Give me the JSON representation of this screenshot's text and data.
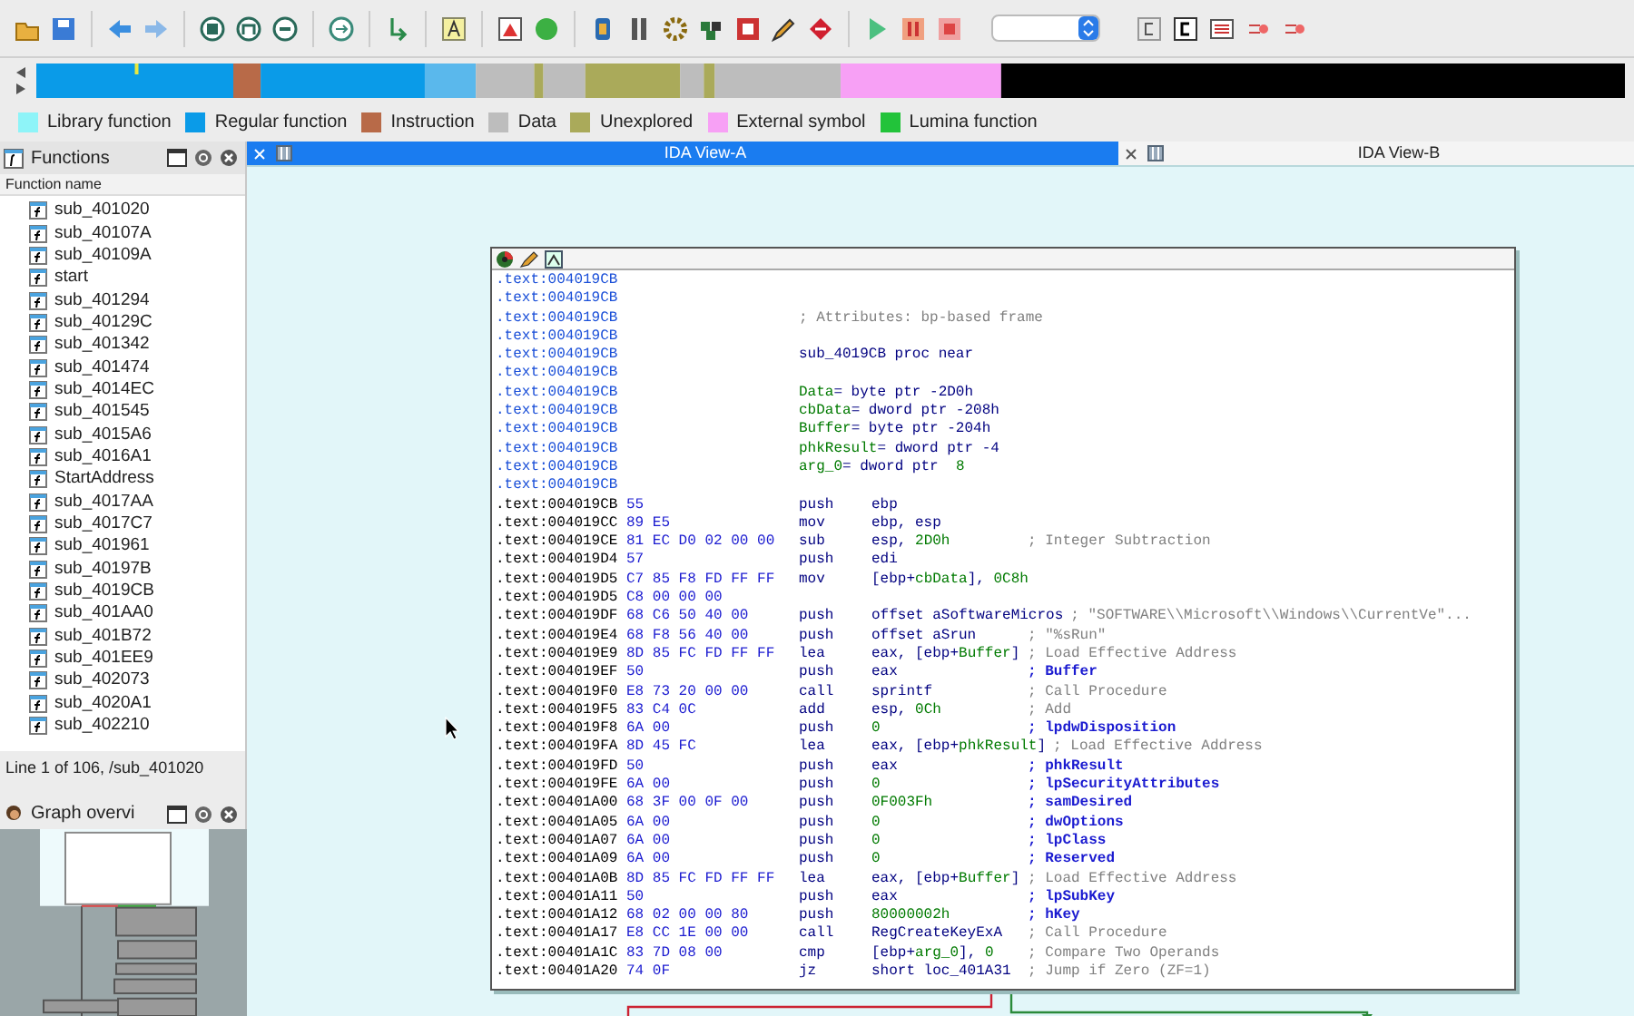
{
  "legend": [
    {
      "label": "Library function",
      "color": "#8ef4f8"
    },
    {
      "label": "Regular function",
      "color": "#0a9be8"
    },
    {
      "label": "Instruction",
      "color": "#b86a48"
    },
    {
      "label": "Data",
      "color": "#bdbdbd"
    },
    {
      "label": "Unexplored",
      "color": "#aaaa5a"
    },
    {
      "label": "External symbol",
      "color": "#f7a0f5"
    },
    {
      "label": "Lumina function",
      "color": "#22c33a"
    }
  ],
  "tabs": [
    {
      "label": "IDA View-A",
      "selected": true
    },
    {
      "label": "IDA View-B",
      "selected": false
    }
  ],
  "functions_panel": {
    "title": "Functions",
    "column": "Function name",
    "items": [
      "sub_401020",
      "sub_40107A",
      "sub_40109A",
      "start",
      "sub_401294",
      "sub_40129C",
      "sub_401342",
      "sub_401474",
      "sub_4014EC",
      "sub_401545",
      "sub_4015A6",
      "sub_4016A1",
      "StartAddress",
      "sub_4017AA",
      "sub_4017C7",
      "sub_401961",
      "sub_40197B",
      "sub_4019CB",
      "sub_401AA0",
      "sub_401B72",
      "sub_401EE9",
      "sub_402073",
      "sub_4020A1",
      "sub_402210"
    ],
    "status": "Line 1 of 106, /sub_401020"
  },
  "graph_overview": {
    "title": "Graph overvi"
  },
  "listing": [
    {
      "kind": "header",
      "addr": ".text:004019CB"
    },
    {
      "kind": "header",
      "addr": ".text:004019CB"
    },
    {
      "kind": "header",
      "addr": ".text:004019CB",
      "ops": [
        {
          "t": "; Attributes: bp-based frame",
          "kind": "note"
        }
      ]
    },
    {
      "kind": "header",
      "addr": ".text:004019CB"
    },
    {
      "kind": "header",
      "addr": ".text:004019CB",
      "ops": [
        {
          "t": "sub_4019CB proc near",
          "kind": "code"
        }
      ]
    },
    {
      "kind": "header",
      "addr": ".text:004019CB"
    },
    {
      "kind": "header",
      "addr": ".text:004019CB",
      "ops": [
        {
          "t": "Data",
          "kind": "var"
        },
        {
          "t": "= byte ptr -2D0h",
          "kind": "code"
        }
      ]
    },
    {
      "kind": "header",
      "addr": ".text:004019CB",
      "ops": [
        {
          "t": "cbData",
          "kind": "var"
        },
        {
          "t": "= dword ptr -208h",
          "kind": "code"
        }
      ]
    },
    {
      "kind": "header",
      "addr": ".text:004019CB",
      "ops": [
        {
          "t": "Buffer",
          "kind": "var"
        },
        {
          "t": "= byte ptr -204h",
          "kind": "code"
        }
      ]
    },
    {
      "kind": "header",
      "addr": ".text:004019CB",
      "ops": [
        {
          "t": "phkResult",
          "kind": "var"
        },
        {
          "t": "= dword ptr -4",
          "kind": "code"
        }
      ]
    },
    {
      "kind": "header",
      "addr": ".text:004019CB",
      "ops": [
        {
          "t": "arg_0",
          "kind": "var"
        },
        {
          "t": "= dword ptr  ",
          "kind": "code"
        },
        {
          "t": "8",
          "kind": "var"
        }
      ]
    },
    {
      "kind": "header",
      "addr": ".text:004019CB"
    },
    {
      "kind": "code",
      "addr": ".text:004019CB",
      "bytes": "55",
      "mnem": "push",
      "ops": [
        {
          "t": "ebp",
          "kind": "code"
        }
      ]
    },
    {
      "kind": "code",
      "addr": ".text:004019CC",
      "bytes": "89 E5",
      "mnem": "mov",
      "ops": [
        {
          "t": "ebp, esp",
          "kind": "code"
        }
      ]
    },
    {
      "kind": "code",
      "addr": ".text:004019CE",
      "bytes": "81 EC D0 02 00 00",
      "mnem": "sub",
      "ops": [
        {
          "t": "esp, ",
          "kind": "code"
        },
        {
          "t": "2D0h",
          "kind": "var"
        }
      ],
      "comment": {
        "t": "; Integer Subtraction",
        "kind": "note"
      }
    },
    {
      "kind": "code",
      "addr": ".text:004019D4",
      "bytes": "57",
      "mnem": "push",
      "ops": [
        {
          "t": "edi",
          "kind": "code"
        }
      ]
    },
    {
      "kind": "code",
      "addr": ".text:004019D5",
      "bytes": "C7 85 F8 FD FF FF",
      "mnem": "mov",
      "ops": [
        {
          "t": "[ebp+",
          "kind": "code"
        },
        {
          "t": "cbData",
          "kind": "var"
        },
        {
          "t": "], ",
          "kind": "code"
        },
        {
          "t": "0C8h",
          "kind": "var"
        }
      ]
    },
    {
      "kind": "code",
      "addr": ".text:004019D5",
      "bytes": "C8 00 00 00"
    },
    {
      "kind": "code",
      "addr": ".text:004019DF",
      "bytes": "68 C6 50 40 00",
      "mnem": "push",
      "ops": [
        {
          "t": "offset aSoftwareMicros",
          "kind": "code"
        }
      ],
      "comment": {
        "t": "; \"SOFTWARE\\\\Microsoft\\\\Windows\\\\CurrentVe\"...",
        "kind": "note"
      }
    },
    {
      "kind": "code",
      "addr": ".text:004019E4",
      "bytes": "68 F8 56 40 00",
      "mnem": "push",
      "ops": [
        {
          "t": "offset aSrun",
          "kind": "code"
        }
      ],
      "comment": {
        "t": "; \"%sRun\"",
        "kind": "note"
      }
    },
    {
      "kind": "code",
      "addr": ".text:004019E9",
      "bytes": "8D 85 FC FD FF FF",
      "mnem": "lea",
      "ops": [
        {
          "t": "eax, [ebp+",
          "kind": "code"
        },
        {
          "t": "Buffer",
          "kind": "var"
        },
        {
          "t": "]",
          "kind": "code"
        }
      ],
      "comment": {
        "t": "; Load Effective Address",
        "kind": "note"
      }
    },
    {
      "kind": "code",
      "addr": ".text:004019EF",
      "bytes": "50",
      "mnem": "push",
      "ops": [
        {
          "t": "eax",
          "kind": "code"
        }
      ],
      "comment": {
        "t": "; Buffer",
        "kind": "arg"
      }
    },
    {
      "kind": "code",
      "addr": ".text:004019F0",
      "bytes": "E8 73 20 00 00",
      "mnem": "call",
      "ops": [
        {
          "t": "sprintf",
          "kind": "code"
        }
      ],
      "comment": {
        "t": "; Call Procedure",
        "kind": "note"
      }
    },
    {
      "kind": "code",
      "addr": ".text:004019F5",
      "bytes": "83 C4 0C",
      "mnem": "add",
      "ops": [
        {
          "t": "esp, ",
          "kind": "code"
        },
        {
          "t": "0Ch",
          "kind": "var"
        }
      ],
      "comment": {
        "t": "; Add",
        "kind": "note"
      }
    },
    {
      "kind": "code",
      "addr": ".text:004019F8",
      "bytes": "6A 00",
      "mnem": "push",
      "ops": [
        {
          "t": "0",
          "kind": "var"
        }
      ],
      "comment": {
        "t": "; lpdwDisposition",
        "kind": "arg"
      }
    },
    {
      "kind": "code",
      "addr": ".text:004019FA",
      "bytes": "8D 45 FC",
      "mnem": "lea",
      "ops": [
        {
          "t": "eax, [ebp+",
          "kind": "code"
        },
        {
          "t": "phkResult",
          "kind": "var"
        },
        {
          "t": "]",
          "kind": "code"
        }
      ],
      "comment": {
        "t": "; Load Effective Address",
        "kind": "note"
      }
    },
    {
      "kind": "code",
      "addr": ".text:004019FD",
      "bytes": "50",
      "mnem": "push",
      "ops": [
        {
          "t": "eax",
          "kind": "code"
        }
      ],
      "comment": {
        "t": "; phkResult",
        "kind": "arg"
      }
    },
    {
      "kind": "code",
      "addr": ".text:004019FE",
      "bytes": "6A 00",
      "mnem": "push",
      "ops": [
        {
          "t": "0",
          "kind": "var"
        }
      ],
      "comment": {
        "t": "; lpSecurityAttributes",
        "kind": "arg"
      }
    },
    {
      "kind": "code",
      "addr": ".text:00401A00",
      "bytes": "68 3F 00 0F 00",
      "mnem": "push",
      "ops": [
        {
          "t": "0F003Fh",
          "kind": "var"
        }
      ],
      "comment": {
        "t": "; samDesired",
        "kind": "arg"
      }
    },
    {
      "kind": "code",
      "addr": ".text:00401A05",
      "bytes": "6A 00",
      "mnem": "push",
      "ops": [
        {
          "t": "0",
          "kind": "var"
        }
      ],
      "comment": {
        "t": "; dwOptions",
        "kind": "arg"
      }
    },
    {
      "kind": "code",
      "addr": ".text:00401A07",
      "bytes": "6A 00",
      "mnem": "push",
      "ops": [
        {
          "t": "0",
          "kind": "var"
        }
      ],
      "comment": {
        "t": "; lpClass",
        "kind": "arg"
      }
    },
    {
      "kind": "code",
      "addr": ".text:00401A09",
      "bytes": "6A 00",
      "mnem": "push",
      "ops": [
        {
          "t": "0",
          "kind": "var"
        }
      ],
      "comment": {
        "t": "; Reserved",
        "kind": "arg"
      }
    },
    {
      "kind": "code",
      "addr": ".text:00401A0B",
      "bytes": "8D 85 FC FD FF FF",
      "mnem": "lea",
      "ops": [
        {
          "t": "eax, [ebp+",
          "kind": "code"
        },
        {
          "t": "Buffer",
          "kind": "var"
        },
        {
          "t": "]",
          "kind": "code"
        }
      ],
      "comment": {
        "t": "; Load Effective Address",
        "kind": "note"
      }
    },
    {
      "kind": "code",
      "addr": ".text:00401A11",
      "bytes": "50",
      "mnem": "push",
      "ops": [
        {
          "t": "eax",
          "kind": "code"
        }
      ],
      "comment": {
        "t": "; lpSubKey",
        "kind": "arg"
      }
    },
    {
      "kind": "code",
      "addr": ".text:00401A12",
      "bytes": "68 02 00 00 80",
      "mnem": "push",
      "ops": [
        {
          "t": "80000002h",
          "kind": "var"
        }
      ],
      "comment": {
        "t": "; hKey",
        "kind": "arg"
      }
    },
    {
      "kind": "code",
      "addr": ".text:00401A17",
      "bytes": "E8 CC 1E 00 00",
      "mnem": "call",
      "ops": [
        {
          "t": "RegCreateKeyExA",
          "kind": "code"
        }
      ],
      "comment": {
        "t": "; Call Procedure",
        "kind": "note"
      }
    },
    {
      "kind": "code",
      "addr": ".text:00401A1C",
      "bytes": "83 7D 08 00",
      "mnem": "cmp",
      "ops": [
        {
          "t": "[ebp+",
          "kind": "code"
        },
        {
          "t": "arg_0",
          "kind": "var"
        },
        {
          "t": "], ",
          "kind": "code"
        },
        {
          "t": "0",
          "kind": "var"
        }
      ],
      "comment": {
        "t": "; Compare Two Operands",
        "kind": "note"
      }
    },
    {
      "kind": "code",
      "addr": ".text:00401A20",
      "bytes": "74 0F",
      "mnem": "jz",
      "ops": [
        {
          "t": "short loc_401A31",
          "kind": "code"
        }
      ],
      "comment": {
        "t": "; Jump if Zero (ZF=1)",
        "kind": "note"
      }
    }
  ]
}
